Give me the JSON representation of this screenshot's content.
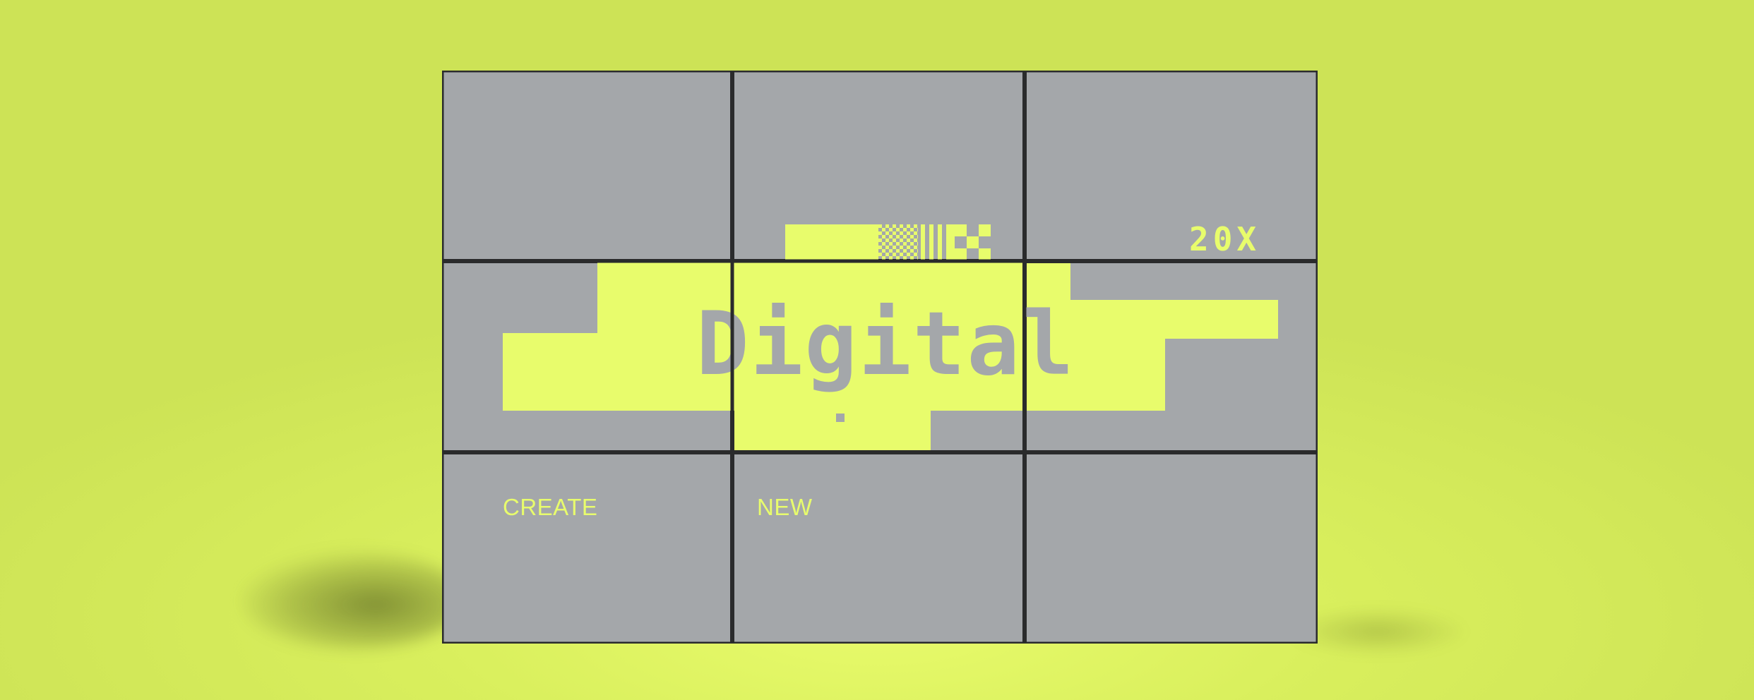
{
  "artwork": {
    "headline": "Digital",
    "badge": "20X",
    "label_left": "CREATE",
    "label_center": "NEW"
  },
  "colors": {
    "background": "#d4e95a",
    "accent_yellow": "#e8fc6c",
    "screen_gray": "#a4a7aa",
    "bezel": "#2a2b2c"
  },
  "video_wall": {
    "rows": 3,
    "columns": 3
  }
}
